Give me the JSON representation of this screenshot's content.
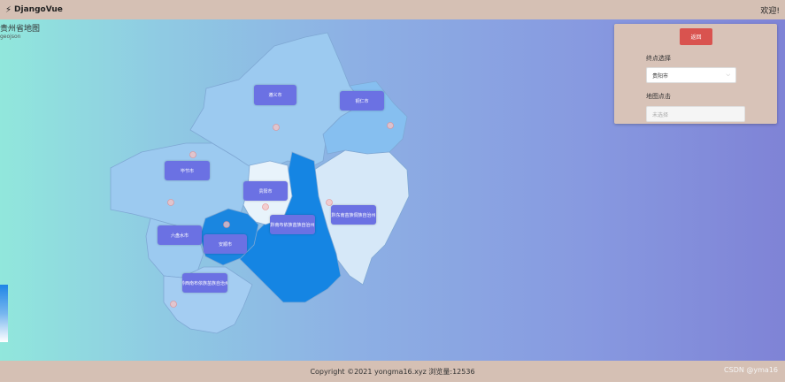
{
  "topbar": {
    "logo_glyph": "⚡",
    "brand": "DjangoVue",
    "welcome": "欢迎!"
  },
  "map": {
    "title": "贵州省地图",
    "subtitle": "geojson",
    "cities": [
      {
        "name": "遵义市",
        "color": "#9ccaf0"
      },
      {
        "name": "铜仁市",
        "color": "#86bff0"
      },
      {
        "name": "毕节市",
        "color": "#9ccaf0"
      },
      {
        "name": "贵阳市",
        "color": "#e8f3fb"
      },
      {
        "name": "黔东南苗族侗族自治州",
        "color": "#d6e8f8"
      },
      {
        "name": "黔南布依族苗族自治州",
        "color": "#1585e3"
      },
      {
        "name": "六盘水市",
        "color": "#9ccaf0"
      },
      {
        "name": "安顺市",
        "color": "#1a86e0"
      },
      {
        "name": "黔西南布依族苗族自治州",
        "color": "#a4cdf2"
      }
    ]
  },
  "panel": {
    "back_button": "返回",
    "endpoint_label": "终点选择",
    "endpoint_value": "贵阳市",
    "map_click_label": "地图点击",
    "map_click_placeholder": "未选择"
  },
  "footer": {
    "copyright": "Copyright ©2021 yongma16.xyz  浏览量:12536",
    "watermark": "CSDN @yma16"
  },
  "colors": {
    "accent": "#6b71e3",
    "danger": "#d9534f",
    "bar": "#d5c0b4"
  }
}
